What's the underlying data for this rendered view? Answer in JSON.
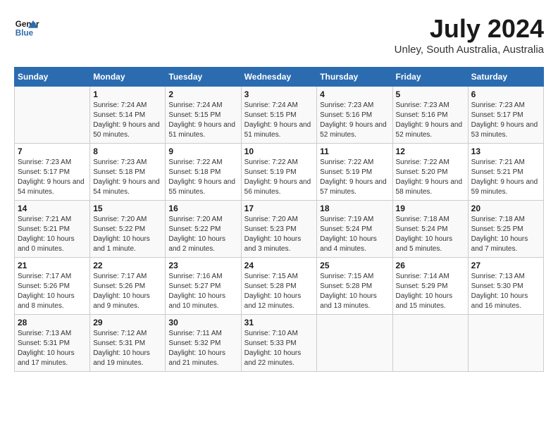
{
  "header": {
    "logo_line1": "General",
    "logo_line2": "Blue",
    "month": "July 2024",
    "location": "Unley, South Australia, Australia"
  },
  "days_of_week": [
    "Sunday",
    "Monday",
    "Tuesday",
    "Wednesday",
    "Thursday",
    "Friday",
    "Saturday"
  ],
  "weeks": [
    [
      {
        "day": "",
        "sunrise": "",
        "sunset": "",
        "daylight": ""
      },
      {
        "day": "1",
        "sunrise": "Sunrise: 7:24 AM",
        "sunset": "Sunset: 5:14 PM",
        "daylight": "Daylight: 9 hours and 50 minutes."
      },
      {
        "day": "2",
        "sunrise": "Sunrise: 7:24 AM",
        "sunset": "Sunset: 5:15 PM",
        "daylight": "Daylight: 9 hours and 51 minutes."
      },
      {
        "day": "3",
        "sunrise": "Sunrise: 7:24 AM",
        "sunset": "Sunset: 5:15 PM",
        "daylight": "Daylight: 9 hours and 51 minutes."
      },
      {
        "day": "4",
        "sunrise": "Sunrise: 7:23 AM",
        "sunset": "Sunset: 5:16 PM",
        "daylight": "Daylight: 9 hours and 52 minutes."
      },
      {
        "day": "5",
        "sunrise": "Sunrise: 7:23 AM",
        "sunset": "Sunset: 5:16 PM",
        "daylight": "Daylight: 9 hours and 52 minutes."
      },
      {
        "day": "6",
        "sunrise": "Sunrise: 7:23 AM",
        "sunset": "Sunset: 5:17 PM",
        "daylight": "Daylight: 9 hours and 53 minutes."
      }
    ],
    [
      {
        "day": "7",
        "sunrise": "Sunrise: 7:23 AM",
        "sunset": "Sunset: 5:17 PM",
        "daylight": "Daylight: 9 hours and 54 minutes."
      },
      {
        "day": "8",
        "sunrise": "Sunrise: 7:23 AM",
        "sunset": "Sunset: 5:18 PM",
        "daylight": "Daylight: 9 hours and 54 minutes."
      },
      {
        "day": "9",
        "sunrise": "Sunrise: 7:22 AM",
        "sunset": "Sunset: 5:18 PM",
        "daylight": "Daylight: 9 hours and 55 minutes."
      },
      {
        "day": "10",
        "sunrise": "Sunrise: 7:22 AM",
        "sunset": "Sunset: 5:19 PM",
        "daylight": "Daylight: 9 hours and 56 minutes."
      },
      {
        "day": "11",
        "sunrise": "Sunrise: 7:22 AM",
        "sunset": "Sunset: 5:19 PM",
        "daylight": "Daylight: 9 hours and 57 minutes."
      },
      {
        "day": "12",
        "sunrise": "Sunrise: 7:22 AM",
        "sunset": "Sunset: 5:20 PM",
        "daylight": "Daylight: 9 hours and 58 minutes."
      },
      {
        "day": "13",
        "sunrise": "Sunrise: 7:21 AM",
        "sunset": "Sunset: 5:21 PM",
        "daylight": "Daylight: 9 hours and 59 minutes."
      }
    ],
    [
      {
        "day": "14",
        "sunrise": "Sunrise: 7:21 AM",
        "sunset": "Sunset: 5:21 PM",
        "daylight": "Daylight: 10 hours and 0 minutes."
      },
      {
        "day": "15",
        "sunrise": "Sunrise: 7:20 AM",
        "sunset": "Sunset: 5:22 PM",
        "daylight": "Daylight: 10 hours and 1 minute."
      },
      {
        "day": "16",
        "sunrise": "Sunrise: 7:20 AM",
        "sunset": "Sunset: 5:22 PM",
        "daylight": "Daylight: 10 hours and 2 minutes."
      },
      {
        "day": "17",
        "sunrise": "Sunrise: 7:20 AM",
        "sunset": "Sunset: 5:23 PM",
        "daylight": "Daylight: 10 hours and 3 minutes."
      },
      {
        "day": "18",
        "sunrise": "Sunrise: 7:19 AM",
        "sunset": "Sunset: 5:24 PM",
        "daylight": "Daylight: 10 hours and 4 minutes."
      },
      {
        "day": "19",
        "sunrise": "Sunrise: 7:18 AM",
        "sunset": "Sunset: 5:24 PM",
        "daylight": "Daylight: 10 hours and 5 minutes."
      },
      {
        "day": "20",
        "sunrise": "Sunrise: 7:18 AM",
        "sunset": "Sunset: 5:25 PM",
        "daylight": "Daylight: 10 hours and 7 minutes."
      }
    ],
    [
      {
        "day": "21",
        "sunrise": "Sunrise: 7:17 AM",
        "sunset": "Sunset: 5:26 PM",
        "daylight": "Daylight: 10 hours and 8 minutes."
      },
      {
        "day": "22",
        "sunrise": "Sunrise: 7:17 AM",
        "sunset": "Sunset: 5:26 PM",
        "daylight": "Daylight: 10 hours and 9 minutes."
      },
      {
        "day": "23",
        "sunrise": "Sunrise: 7:16 AM",
        "sunset": "Sunset: 5:27 PM",
        "daylight": "Daylight: 10 hours and 10 minutes."
      },
      {
        "day": "24",
        "sunrise": "Sunrise: 7:15 AM",
        "sunset": "Sunset: 5:28 PM",
        "daylight": "Daylight: 10 hours and 12 minutes."
      },
      {
        "day": "25",
        "sunrise": "Sunrise: 7:15 AM",
        "sunset": "Sunset: 5:28 PM",
        "daylight": "Daylight: 10 hours and 13 minutes."
      },
      {
        "day": "26",
        "sunrise": "Sunrise: 7:14 AM",
        "sunset": "Sunset: 5:29 PM",
        "daylight": "Daylight: 10 hours and 15 minutes."
      },
      {
        "day": "27",
        "sunrise": "Sunrise: 7:13 AM",
        "sunset": "Sunset: 5:30 PM",
        "daylight": "Daylight: 10 hours and 16 minutes."
      }
    ],
    [
      {
        "day": "28",
        "sunrise": "Sunrise: 7:13 AM",
        "sunset": "Sunset: 5:31 PM",
        "daylight": "Daylight: 10 hours and 17 minutes."
      },
      {
        "day": "29",
        "sunrise": "Sunrise: 7:12 AM",
        "sunset": "Sunset: 5:31 PM",
        "daylight": "Daylight: 10 hours and 19 minutes."
      },
      {
        "day": "30",
        "sunrise": "Sunrise: 7:11 AM",
        "sunset": "Sunset: 5:32 PM",
        "daylight": "Daylight: 10 hours and 21 minutes."
      },
      {
        "day": "31",
        "sunrise": "Sunrise: 7:10 AM",
        "sunset": "Sunset: 5:33 PM",
        "daylight": "Daylight: 10 hours and 22 minutes."
      },
      {
        "day": "",
        "sunrise": "",
        "sunset": "",
        "daylight": ""
      },
      {
        "day": "",
        "sunrise": "",
        "sunset": "",
        "daylight": ""
      },
      {
        "day": "",
        "sunrise": "",
        "sunset": "",
        "daylight": ""
      }
    ]
  ]
}
